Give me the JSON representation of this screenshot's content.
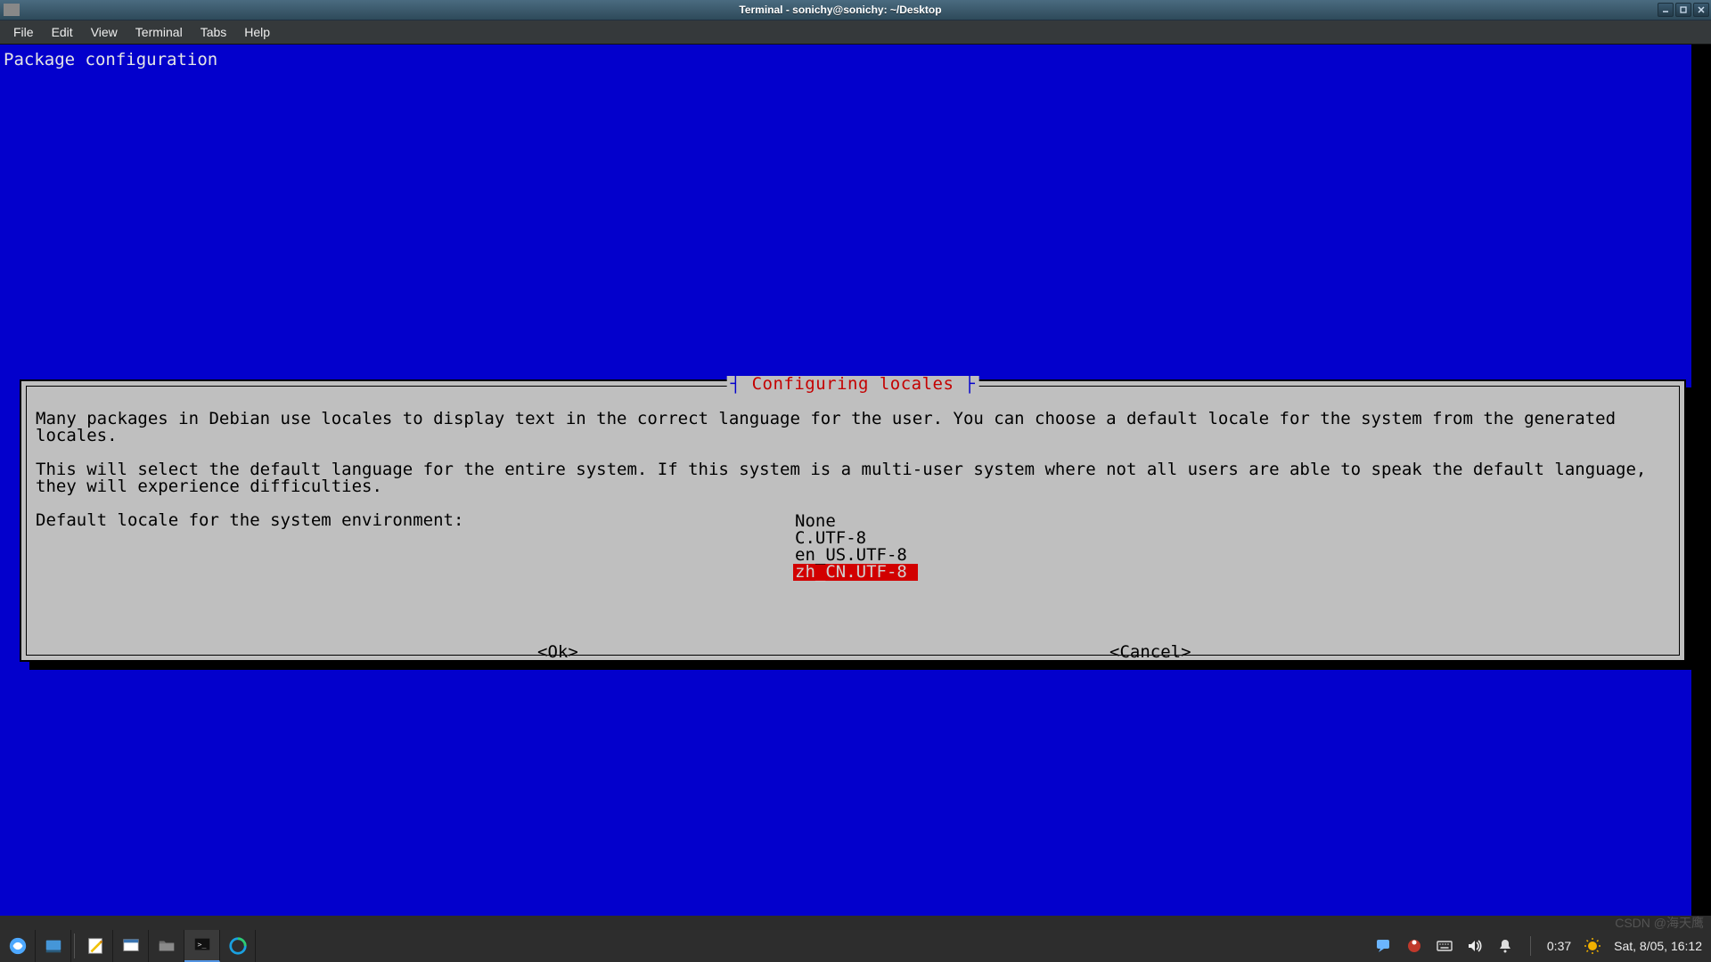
{
  "window": {
    "title": "Terminal - sonichy@sonichy: ~/Desktop"
  },
  "menubar": {
    "items": [
      "File",
      "Edit",
      "View",
      "Terminal",
      "Tabs",
      "Help"
    ]
  },
  "terminal": {
    "header": "Package configuration"
  },
  "dialog": {
    "title": "Configuring locales",
    "body_line1": "Many packages in Debian use locales to display text in the correct language for the user. You can choose a default locale for the system from the generated locales.",
    "body_line2": "This will select the default language for the entire system. If this system is a multi-user system where not all users are able to speak the default language, they will experience difficulties.",
    "body_line3": "Default locale for the system environment:",
    "options": [
      "None",
      "C.UTF-8",
      "en_US.UTF-8",
      "zh_CN.UTF-8"
    ],
    "selected_index": 3,
    "ok_label": "<Ok>",
    "cancel_label": "<Cancel>"
  },
  "taskbar": {
    "time": "0:37",
    "date": "Sat, 8/05, 16:12"
  },
  "watermark": "CSDN @海天鹰"
}
